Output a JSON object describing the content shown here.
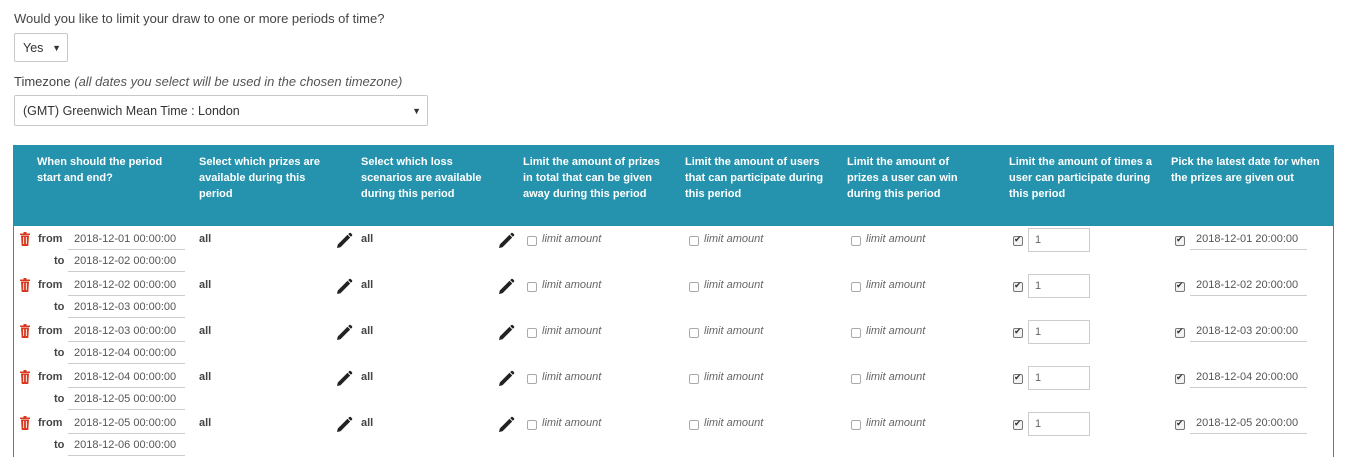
{
  "question": "Would you like to limit your draw to one or more periods of time?",
  "limit_select": {
    "value": "Yes"
  },
  "timezone": {
    "label": "Timezone",
    "note": "(all dates you select will be used in the chosen timezone)",
    "value": "(GMT) Greenwich Mean Time : London"
  },
  "headers": [
    "When should the period start and end?",
    "Select which prizes are available during this period",
    "Select which loss scenarios are available during this period",
    "Limit the amount of prizes in total that can be given away during this period",
    "Limit the amount of users that can participate during this period",
    "Limit the amount of prizes a user can win during this period",
    "Limit the amount of times a user can participate during this period",
    "Pick the latest date for when the prizes are given out"
  ],
  "labels": {
    "from": "from",
    "to": "to",
    "all": "all",
    "limit": "limit amount"
  },
  "rows": [
    {
      "from": "2018-12-01 00:00:00",
      "to": "2018-12-02 00:00:00",
      "times": "1",
      "latest": "2018-12-01 20:00:00"
    },
    {
      "from": "2018-12-02 00:00:00",
      "to": "2018-12-03 00:00:00",
      "times": "1",
      "latest": "2018-12-02 20:00:00"
    },
    {
      "from": "2018-12-03 00:00:00",
      "to": "2018-12-04 00:00:00",
      "times": "1",
      "latest": "2018-12-03 20:00:00"
    },
    {
      "from": "2018-12-04 00:00:00",
      "to": "2018-12-05 00:00:00",
      "times": "1",
      "latest": "2018-12-04 20:00:00"
    },
    {
      "from": "2018-12-05 00:00:00",
      "to": "2018-12-06 00:00:00",
      "times": "1",
      "latest": "2018-12-05 20:00:00"
    }
  ],
  "colors": {
    "header_bg": "#2593ad",
    "trash": "#d9381e"
  }
}
